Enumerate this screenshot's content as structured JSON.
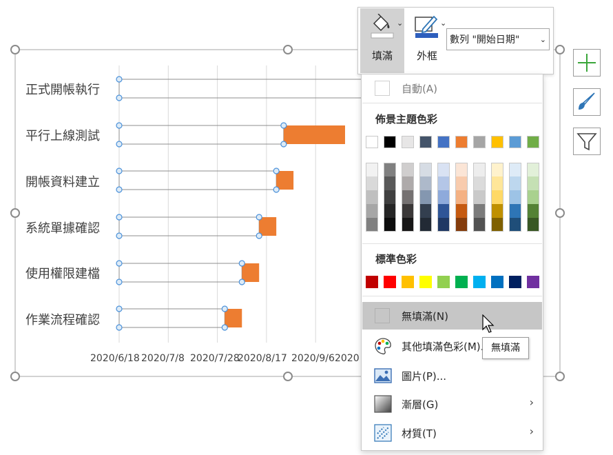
{
  "chart": {
    "categories": [
      "正式開帳執行",
      "平行上線測試",
      "開帳資料建立",
      "系統單據確認",
      "使用權限建檔",
      "作業流程確認"
    ],
    "date_axis": [
      "2020/6/18",
      "2020/7/8",
      "2020/7/28",
      "2020/8/17",
      "2020/9/6",
      "2020"
    ]
  },
  "chart_data": {
    "type": "bar",
    "orientation": "horizontal-stacked-gantt",
    "categories": [
      "正式開帳執行",
      "平行上線測試",
      "開帳資料建立",
      "系統單據確認",
      "使用權限建檔",
      "作業流程確認"
    ],
    "x_tick_labels": [
      "2020/6/18",
      "2020/7/8",
      "2020/7/28",
      "2020/8/17",
      "2020/9/6",
      "2020"
    ],
    "series": [
      {
        "role": "start",
        "fill": "none",
        "values": [
          "2020/10/6",
          "2020/8/24",
          "2020/8/21",
          "2020/8/14",
          "2020/8/7",
          "2020/7/31"
        ]
      },
      {
        "role": "duration_days",
        "color": "#ed7d31",
        "values": [
          0,
          25,
          7,
          7,
          7,
          7
        ]
      }
    ]
  },
  "ribbon": {
    "fill_label": "填滿",
    "outline_label": "外框",
    "series_select": "數列 \"開始日期\""
  },
  "menu": {
    "auto_label": "自動(A)",
    "theme_heading": "佈景主題色彩",
    "standard_heading": "標準色彩",
    "no_fill_label": "無填滿(N)",
    "more_colors_label": "其他填滿色彩(M)...",
    "picture_label": "圖片(P)...",
    "gradient_label": "漸層(G)",
    "texture_label": "材質(T)",
    "theme_top": [
      "#ffffff",
      "#000000",
      "#e7e6e6",
      "#44546a",
      "#4472c4",
      "#ed7d31",
      "#a5a5a5",
      "#ffc000",
      "#5b9bd5",
      "#70ad47"
    ],
    "theme_shades": [
      [
        "#f2f2f2",
        "#d9d9d9",
        "#bfbfbf",
        "#a6a6a6",
        "#808080"
      ],
      [
        "#808080",
        "#595959",
        "#404040",
        "#262626",
        "#0d0d0d"
      ],
      [
        "#d0cece",
        "#aeaaaa",
        "#757171",
        "#3b3838",
        "#171616"
      ],
      [
        "#d6dce4",
        "#adb9ca",
        "#8497b0",
        "#333f4f",
        "#222a35"
      ],
      [
        "#d9e2f3",
        "#b4c6e7",
        "#8eaadb",
        "#2f5597",
        "#1f3864"
      ],
      [
        "#fbe5d6",
        "#f8cbad",
        "#f4b183",
        "#c55a11",
        "#843c0c"
      ],
      [
        "#ededed",
        "#dbdbdb",
        "#c9c9c9",
        "#7b7b7b",
        "#525252"
      ],
      [
        "#fff2cc",
        "#ffe699",
        "#ffd966",
        "#bf9000",
        "#7f6000"
      ],
      [
        "#deebf7",
        "#bdd7ee",
        "#9dc3e6",
        "#2e75b6",
        "#1f4e79"
      ],
      [
        "#e2f0d9",
        "#c5e0b4",
        "#a9d18e",
        "#548235",
        "#385723"
      ]
    ],
    "standard": [
      "#c00000",
      "#ff0000",
      "#ffc000",
      "#ffff00",
      "#92d050",
      "#00b050",
      "#00b0f0",
      "#0070c0",
      "#002060",
      "#7030a0"
    ]
  },
  "tooltip": {
    "text": "無填滿"
  },
  "side": {
    "add_color": "#3aa63a",
    "brush_color": "#2e75b6"
  }
}
